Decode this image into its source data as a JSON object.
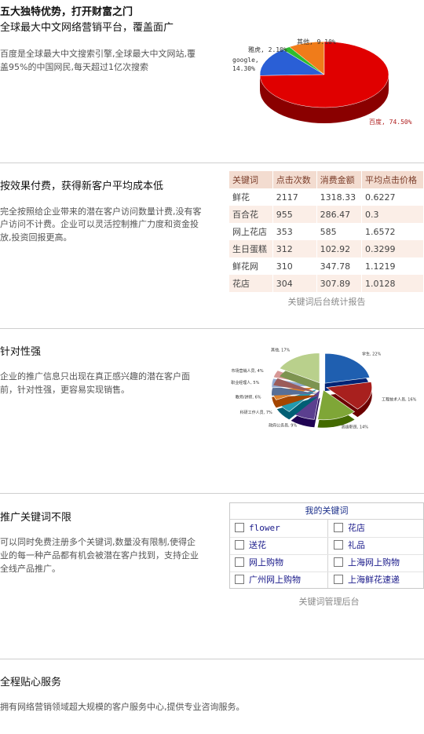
{
  "intro": {
    "title": "五大独特优势，打开财富之门",
    "subtitle": "全球最大中文网络营销平台，覆盖面广",
    "desc_line1": "百度是全球最大中文搜索引擎,全球最大中文网站,覆",
    "desc_line2": "盖95%的中国网民,每天超过1亿次搜索"
  },
  "share_chart": {
    "chart_data": {
      "type": "pie",
      "categories": [
        "百度",
        "google",
        "雅虎",
        "其他"
      ],
      "values": [
        74.5,
        14.3,
        2.1,
        9.1
      ],
      "labels": [
        "百度, 74.50%",
        "google, 14.30%",
        "雅虎, 2.10%",
        "其他, 9.10%"
      ],
      "colors": [
        "#e00000",
        "#2a5fd6",
        "#2ebd2e",
        "#f07c1a"
      ]
    }
  },
  "section2": {
    "title": "按效果付费，获得新客户平均成本低",
    "desc_line1": "完全按照给企业带来的潜在客户访问数量计费,没有客",
    "desc_line2": "户访问不计费。企业可以灵活控制推广力度和资金投",
    "desc_line3": "放,投资回报更高。",
    "table": {
      "headers": [
        "关键词",
        "点击次数",
        "消费金额",
        "平均点击价格"
      ],
      "rows": [
        [
          "鲜花",
          "2117",
          "1318.33",
          "0.6227"
        ],
        [
          "百合花",
          "955",
          "286.47",
          "0.3"
        ],
        [
          "网上花店",
          "353",
          "585",
          "1.6572"
        ],
        [
          "生日蛋糕",
          "312",
          "102.92",
          "0.3299"
        ],
        [
          "鲜花网",
          "310",
          "347.78",
          "1.1219"
        ],
        [
          "花店",
          "304",
          "307.89",
          "1.0128"
        ]
      ],
      "caption": "关键词后台统计报告"
    }
  },
  "section3": {
    "title": "针对性强",
    "desc_line1": "企业的推广信息只出现在真正感兴趣的潜在客户面",
    "desc_line2": "前，针对性强，更容易实现销售。",
    "chart_data": {
      "type": "pie",
      "categories": [
        "学生",
        "工程技术人员",
        "高级职员",
        "政府公务员",
        "科研工作人员",
        "教师/讲师",
        "职业经理人",
        "市场营销人员",
        "其他"
      ],
      "values": [
        22,
        16,
        14,
        9,
        7,
        6,
        5,
        4,
        17
      ],
      "labels": [
        "学生, 22%",
        "工程技术人员, 16%",
        "高级职员, 14%",
        "政府公务员, 9%",
        "科研工作人员, 7%",
        "教师/讲师, 6%",
        "职业经理人, 5%",
        "市场营销人员, 4%",
        "其他, 17%"
      ],
      "colors": [
        "#1f5fb0",
        "#a8201e",
        "#7fa637",
        "#5b3f8f",
        "#239bb0",
        "#e0822a",
        "#93abd3",
        "#d79896",
        "#b9d08c"
      ]
    }
  },
  "section4": {
    "title": "推广关键词不限",
    "desc_line1": "可以同时免费注册多个关键词,数量没有限制,使得企",
    "desc_line2": "业的每一种产品都有机会被潜在客户找到，支持企业",
    "desc_line3": "全线产品推广。",
    "box_title": "我的关键词",
    "keywords": [
      [
        "flower",
        "花店"
      ],
      [
        "送花",
        "礼品"
      ],
      [
        "网上购物",
        "上海网上购物"
      ],
      [
        "广州网上购物",
        "上海鲜花速递"
      ]
    ],
    "caption": "关键词管理后台"
  },
  "section5": {
    "title": "全程贴心服务",
    "desc": "拥有网络营销领域超大规模的客户服务中心,提供专业咨询服务。"
  }
}
